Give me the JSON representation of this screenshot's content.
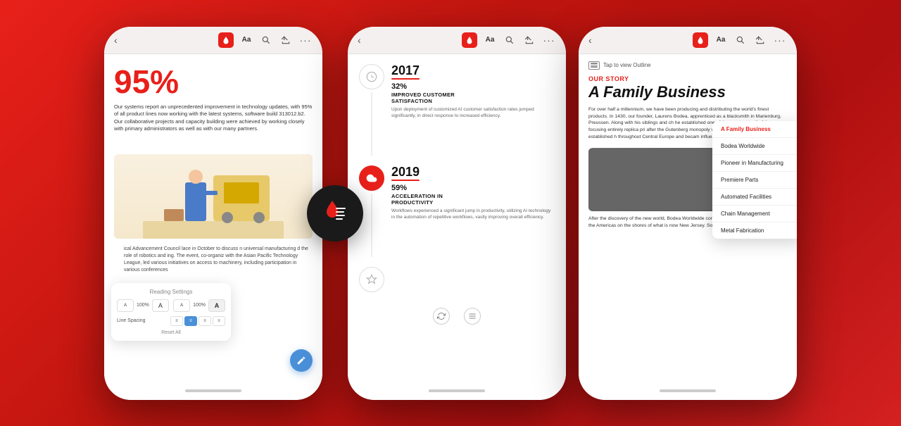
{
  "background": {
    "gradient_start": "#e8201a",
    "gradient_end": "#b01010"
  },
  "phone1": {
    "nav_back": "‹",
    "toolbar_icons": [
      "droplet",
      "Aa",
      "search",
      "share",
      "more"
    ],
    "stat_percent": "95%",
    "body_text": "Our systems report an unprecedented improvement in technology updates, with 95% of all product lines now working with the latest systems, software build 313012.b2. Our collaborative projects and capacity building were achieved by working closely with primary administrators as well as with our many partners.",
    "reading_settings_label": "Reading Settings",
    "font_size_small": "A",
    "font_size_large": "A",
    "font_size_percent": "100%",
    "bold_label": "A",
    "bold_percent": "100%",
    "spacing_label": "Line Spacing",
    "reset_label": "Reset All",
    "body_text2": "ical Advancement Council lace in October to discuss n universal manufacturing d the role of robotics and ing. The event, co-organiz with the Asian Pacific Technology League, led various initiatives on access to machinery, including participation in various conferences"
  },
  "phone2": {
    "nav_back": "‹",
    "timeline": [
      {
        "year": "2017",
        "stat": "32%",
        "stat_label": "IMPROVED CUSTOMER SATISFACTION",
        "desc": "Upon deployment of customized AI customer satisfaction rates jumped significantly, in direct response to increased efficiency.",
        "active": false
      },
      {
        "year": "2019",
        "stat": "59%",
        "stat_label": "ACCELERATION IN PRODUCTIVITY",
        "desc": "Workflows experienced a significant jump in productivity, utilizing AI technology in the automation of repetitive workflows, vastly improving overall efficiency.",
        "active": true
      }
    ]
  },
  "phone3": {
    "nav_back": "‹",
    "outline_hint": "Tap to view Outline",
    "story_label": "OUR STORY",
    "story_title": "A Family Business",
    "story_body": "For over half a millennium, we have been producing and distributing the world's finest products. In 1430, our founder, Laurens Bodea, apprenticed as a blacksmith in Marienburg, Preussen. Along with his siblings and ch he established one of the greatest tradi of the era — focusing entirely replica pri after the Gutenberg monopoly was revol mid-15th century. Bodea established h throughout Central Europe and becam influence in the Hanseatic League.",
    "story_body2": "After the discovery of the new world, Bodea Worldwide constructed one of the first factories in the Americas on the shores of what is now New Jersey. Some su",
    "outline_items": [
      {
        "label": "A Family Business",
        "active": true
      },
      {
        "label": "Bodea Worldwide",
        "active": false
      },
      {
        "label": "Pioneer in Manufacturing",
        "active": false
      },
      {
        "label": "Premiere Parts",
        "active": false
      },
      {
        "label": "Automated Facilities",
        "active": false
      },
      {
        "label": "Chain Management",
        "active": false
      },
      {
        "label": "Metal Fabrication",
        "active": false
      }
    ]
  },
  "center_icon": "droplet-list"
}
